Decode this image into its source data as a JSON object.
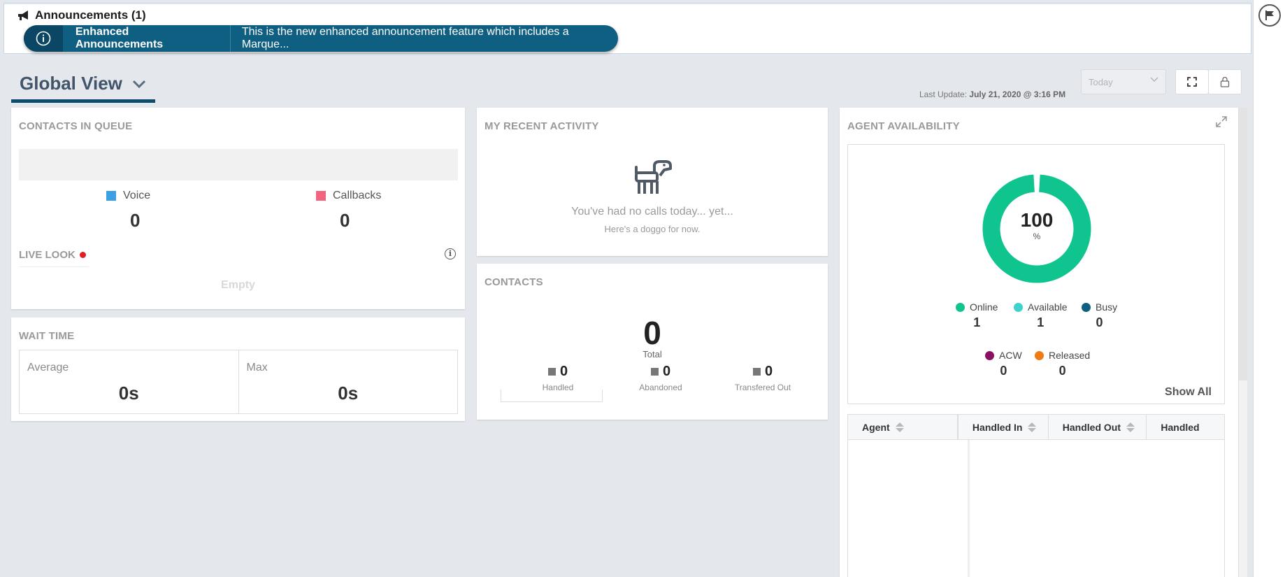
{
  "announcements": {
    "title": "Announcements (1)",
    "label": "Enhanced Announcements",
    "message": "This is the new enhanced announcement feature which includes a Marque..."
  },
  "header": {
    "view_title": "Global View",
    "last_update_label": "Last Update:",
    "last_update_value": "July 21, 2020 @ 3:16 PM",
    "date_range_selected": "Today"
  },
  "contacts_in_queue": {
    "title": "CONTACTS IN QUEUE",
    "voice_label": "Voice",
    "voice_value": "0",
    "callbacks_label": "Callbacks",
    "callbacks_value": "0",
    "voice_color": "#3b9fe3",
    "callbacks_color": "#f0647f",
    "live_look_label": "LIVE LOOK",
    "live_look_empty": "Empty"
  },
  "wait_time": {
    "title": "WAIT TIME",
    "average_label": "Average",
    "average_value": "0s",
    "max_label": "Max",
    "max_value": "0s"
  },
  "recent_activity": {
    "title": "MY RECENT ACTIVITY",
    "empty_line1": "You've had no calls today... yet...",
    "empty_line2": "Here's a doggo for now."
  },
  "contacts": {
    "title": "CONTACTS",
    "total_value": "0",
    "total_label": "Total",
    "handled_value": "0",
    "handled_label": "Handled",
    "abandoned_value": "0",
    "abandoned_label": "Abandoned",
    "transferred_value": "0",
    "transferred_label": "Transfered Out"
  },
  "agent_availability": {
    "title": "AGENT AVAILABILITY",
    "percent_value": "100",
    "percent_unit": "%",
    "online_percent": 100,
    "states": {
      "online": {
        "label": "Online",
        "value": "1",
        "color": "#10c48f"
      },
      "available": {
        "label": "Available",
        "value": "1",
        "color": "#3dd2cc"
      },
      "busy": {
        "label": "Busy",
        "value": "0",
        "color": "#0f5f83"
      },
      "acw": {
        "label": "ACW",
        "value": "0",
        "color": "#8c1062"
      },
      "released": {
        "label": "Released",
        "value": "0",
        "color": "#f07b14"
      }
    },
    "show_all": "Show All",
    "table_headers": [
      "Agent",
      "Handled In",
      "Handled Out",
      "Handled"
    ]
  }
}
